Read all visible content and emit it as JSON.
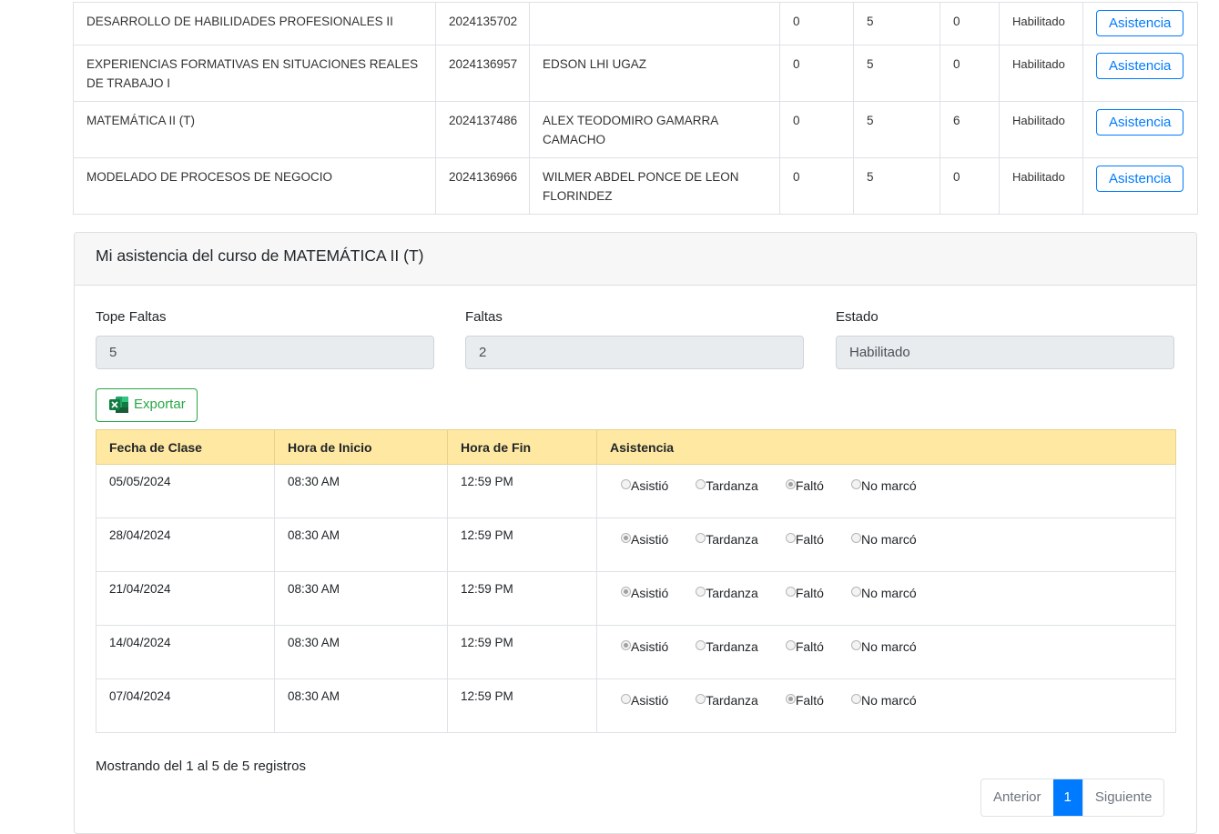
{
  "courses": [
    {
      "name": "DESARROLLO DE HABILIDADES PROFESIONALES II",
      "code": "2024135702",
      "teacher": "",
      "c1": "0",
      "c2": "5",
      "c3": "0",
      "c3_status": "ok",
      "state": "Habilitado",
      "action": "Asistencia"
    },
    {
      "name": "EXPERIENCIAS FORMATIVAS EN SITUACIONES REALES DE TRABAJO I",
      "code": "2024136957",
      "teacher": "EDSON LHI UGAZ",
      "c1": "0",
      "c2": "5",
      "c3": "0",
      "c3_status": "ok",
      "state": "Habilitado",
      "action": "Asistencia"
    },
    {
      "name": "MATEMÁTICA II (T)",
      "code": "2024137486",
      "teacher": "ALEX TEODOMIRO GAMARRA CAMACHO",
      "c1": "0",
      "c2": "5",
      "c3": "6",
      "c3_status": "bad",
      "state": "Habilitado",
      "action": "Asistencia"
    },
    {
      "name": "MODELADO DE PROCESOS DE NEGOCIO",
      "code": "2024136966",
      "teacher": "WILMER ABDEL PONCE DE LEON FLORINDEZ",
      "c1": "0",
      "c2": "5",
      "c3": "0",
      "c3_status": "ok",
      "state": "Habilitado",
      "action": "Asistencia"
    }
  ],
  "colors": {
    "ok": "#28a745",
    "bad": "#dc3545",
    "primary": "#007bff",
    "header_bg": "#ffe8a1"
  },
  "card": {
    "title": "Mi asistencia del curso de MATEMÁTICA II (T)",
    "fields": {
      "tope_label": "Tope Faltas",
      "tope_value": "5",
      "faltas_label": "Faltas",
      "faltas_value": "2",
      "estado_label": "Estado",
      "estado_value": "Habilitado"
    },
    "export_label": "Exportar",
    "export_icon": "excel-icon"
  },
  "attendance": {
    "headers": {
      "fecha": "Fecha de Clase",
      "inicio": "Hora de Inicio",
      "fin": "Hora de Fin",
      "asistencia": "Asistencia"
    },
    "options": [
      "Asistió",
      "Tardanza",
      "Faltó",
      "No marcó"
    ],
    "rows": [
      {
        "fecha": "05/05/2024",
        "inicio": "08:30 AM",
        "fin": "12:59 PM",
        "selected": "Faltó"
      },
      {
        "fecha": "28/04/2024",
        "inicio": "08:30 AM",
        "fin": "12:59 PM",
        "selected": "Asistió"
      },
      {
        "fecha": "21/04/2024",
        "inicio": "08:30 AM",
        "fin": "12:59 PM",
        "selected": "Asistió"
      },
      {
        "fecha": "14/04/2024",
        "inicio": "08:30 AM",
        "fin": "12:59 PM",
        "selected": "Asistió"
      },
      {
        "fecha": "07/04/2024",
        "inicio": "08:30 AM",
        "fin": "12:59 PM",
        "selected": "Faltó"
      }
    ],
    "summary": "Mostrando del 1 al 5 de 5 registros"
  },
  "pagination": {
    "prev": "Anterior",
    "current": "1",
    "next": "Siguiente"
  }
}
